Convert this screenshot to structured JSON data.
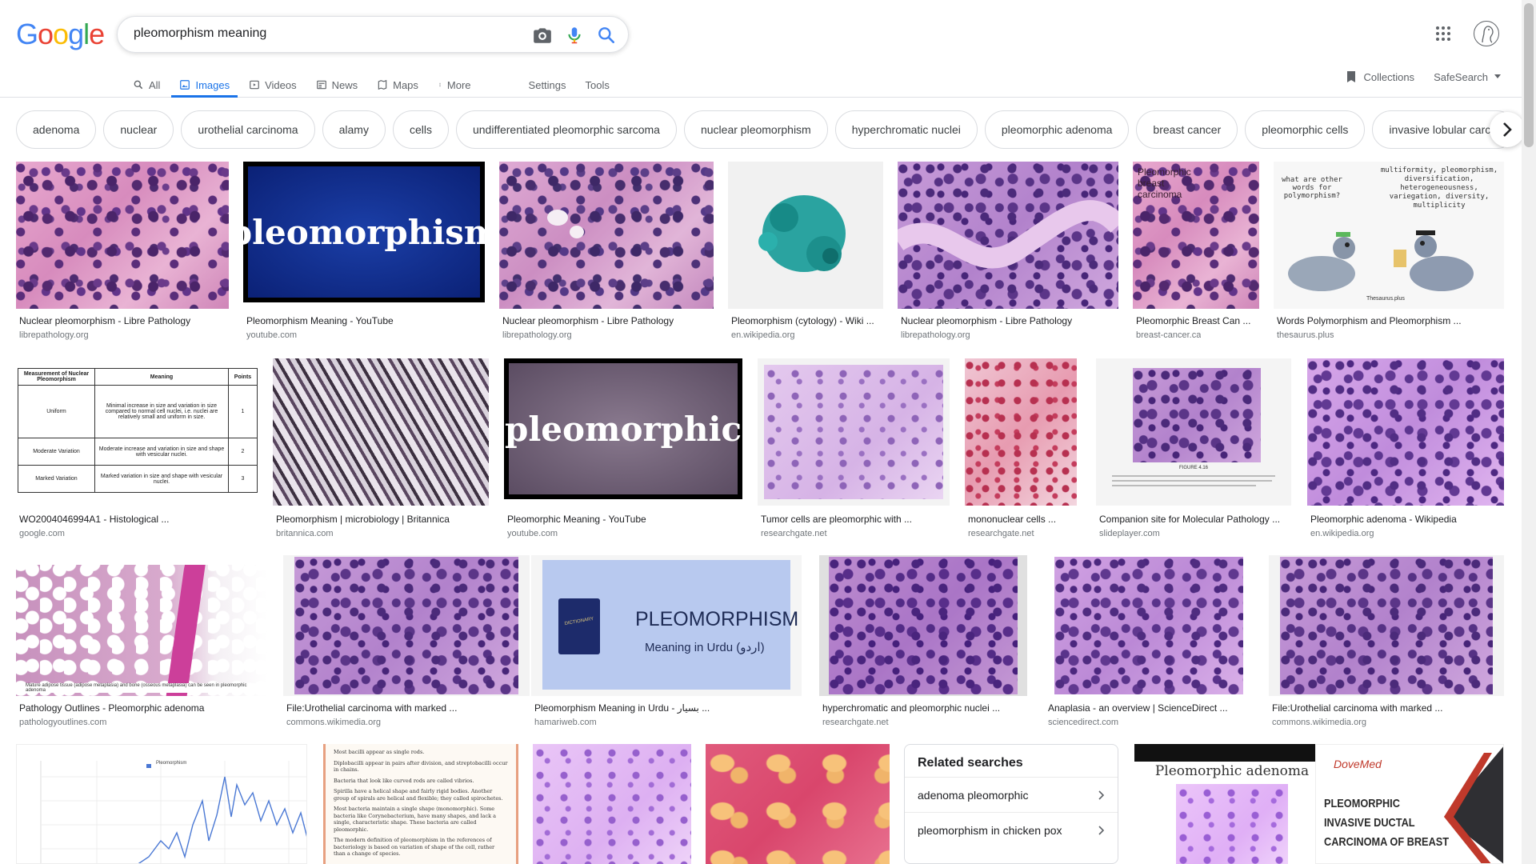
{
  "logo": {
    "letters": [
      "G",
      "o",
      "o",
      "g",
      "l",
      "e"
    ],
    "colors": [
      "#4285f4",
      "#ea4335",
      "#fbbc05",
      "#4285f4",
      "#34a853",
      "#ea4335"
    ]
  },
  "search": {
    "value": "pleomorphism meaning"
  },
  "tabs": [
    {
      "label": "All",
      "icon": "search-icon"
    },
    {
      "label": "Images",
      "icon": "image-icon",
      "active": true
    },
    {
      "label": "Videos",
      "icon": "video-icon"
    },
    {
      "label": "News",
      "icon": "news-icon"
    },
    {
      "label": "Maps",
      "icon": "map-icon"
    },
    {
      "label": "More",
      "icon": "more-vert-icon"
    }
  ],
  "tools": {
    "settings": "Settings",
    "tools": "Tools"
  },
  "right_tools": {
    "collections": "Collections",
    "safesearch": "SafeSearch"
  },
  "chips": [
    "adenoma",
    "nuclear",
    "urothelial carcinoma",
    "alamy",
    "cells",
    "undifferentiated pleomorphic sarcoma",
    "nuclear pleomorphism",
    "hyperchromatic nuclei",
    "pleomorphic adenoma",
    "breast cancer",
    "pleomorphic cells",
    "invasive lobular carcin"
  ],
  "results": {
    "r1": [
      {
        "title": "Nuclear pleomorphism - Libre Pathology",
        "source": "librepathology.org"
      },
      {
        "title": "Pleomorphism Meaning - YouTube",
        "source": "youtube.com",
        "thumb_text": "pleomorphism"
      },
      {
        "title": "Nuclear pleomorphism - Libre Pathology",
        "source": "librepathology.org"
      },
      {
        "title": "Pleomorphism (cytology) - Wiki ...",
        "source": "en.wikipedia.org"
      },
      {
        "title": "Nuclear pleomorphism - Libre Pathology",
        "source": "librepathology.org"
      },
      {
        "title": "Pleomorphic Breast Can ...",
        "source": "breast-cancer.ca",
        "thumb_text": "Pleomorphic breast carcinoma"
      },
      {
        "title": "Words Polymorphism and Pleomorphism ...",
        "source": "thesaurus.plus",
        "thumb_q": "what are other words for polymorphism?",
        "thumb_a": "multiformity, pleomorphism, diversification, heterogeneousness, variegation, diversity, multiplicity",
        "thumb_brand": "Thesaurus.plus"
      }
    ],
    "r2": [
      {
        "title": "WO2004046994A1 - Histological ...",
        "source": "google.com",
        "table": {
          "headers": [
            "Measurement of Nuclear Pleomorphism",
            "Meaning",
            "Points"
          ],
          "rows": [
            [
              "Uniform",
              "Minimal increase in size and variation in size compared to normal cell nuclei, i.e. nuclei are relatively small and uniform in size.",
              "1"
            ],
            [
              "Moderate Variation",
              "Moderate increase and variation in size and shape with vesicular nuclei.",
              "2"
            ],
            [
              "Marked Variation",
              "Marked variation in size and shape with vesicular nuclei.",
              "3"
            ]
          ]
        }
      },
      {
        "title": "Pleomorphism | microbiology | Britannica",
        "source": "britannica.com"
      },
      {
        "title": "Pleomorphic Meaning - YouTube",
        "source": "youtube.com",
        "thumb_text": "pleomorphic"
      },
      {
        "title": "Tumor cells are pleomorphic with ...",
        "source": "researchgate.net"
      },
      {
        "title": "mononuclear cells ...",
        "source": "researchgate.net"
      },
      {
        "title": "Companion site for Molecular Pathology ...",
        "source": "slideplayer.com",
        "thumb_caption": "FIGURE 4.16"
      },
      {
        "title": "Pleomorphic adenoma - Wikipedia",
        "source": "en.wikipedia.org"
      }
    ],
    "r3": [
      {
        "title": "Pathology Outlines - Pleomorphic adenoma",
        "source": "pathologyoutlines.com",
        "thumb_caption": "Mature adipose tissue (adipose metaplasia) and bone (osseous metaplasia) can be seen in pleomorphic adenoma"
      },
      {
        "title": "File:Urothelial carcinoma with marked ...",
        "source": "commons.wikimedia.org"
      },
      {
        "title": "Pleomorphism Meaning in Urdu - بسیار ...",
        "source": "hamariweb.com",
        "thumb_big": "PLEOMORPHISM",
        "thumb_small": "Meaning in Urdu (اردو)",
        "thumb_book": "DICTIONARY"
      },
      {
        "title": "hyperchromatic and pleomorphic nuclei ...",
        "source": "researchgate.net"
      },
      {
        "title": "Anaplasia - an overview | ScienceDirect ...",
        "source": "sciencedirect.com"
      },
      {
        "title": "File:Urothelial carcinoma with marked ...",
        "source": "commons.wikimedia.org"
      }
    ],
    "r4": [
      {
        "legend": "Pleomorphism"
      },
      {
        "lines": [
          "Most bacilli appear as single rods.",
          "Diplobacilli appear in pairs after division, and streptobacilli occur in chains.",
          "Bacteria that look like curved rods are called vibrios.",
          "Spirilla have a helical shape and fairly rigid bodies. Another group of spirals are helical and flexible; they called spirochetes.",
          "Most bacteria maintain a single shape (monomorphic). Some bacteria like Corynebacterium, have many shapes, and lack a single, characteristic shape. These bacteria are called pleomorphic.",
          "The modern definition of pleomorphism in the references of bacteriology is based on variation of shape of the cell, rather than a change of species."
        ]
      },
      {},
      {},
      {
        "thumb_text": "Pleomorphic adenoma"
      },
      {
        "brand": "DoveMed",
        "lines": [
          "PLEOMORPHIC",
          "INVASIVE DUCTAL",
          "CARCINOMA OF BREAST"
        ]
      }
    ]
  },
  "related": {
    "title": "Related searches",
    "items": [
      "adenoma pleomorphic",
      "pleomorphism in chicken pox"
    ]
  }
}
